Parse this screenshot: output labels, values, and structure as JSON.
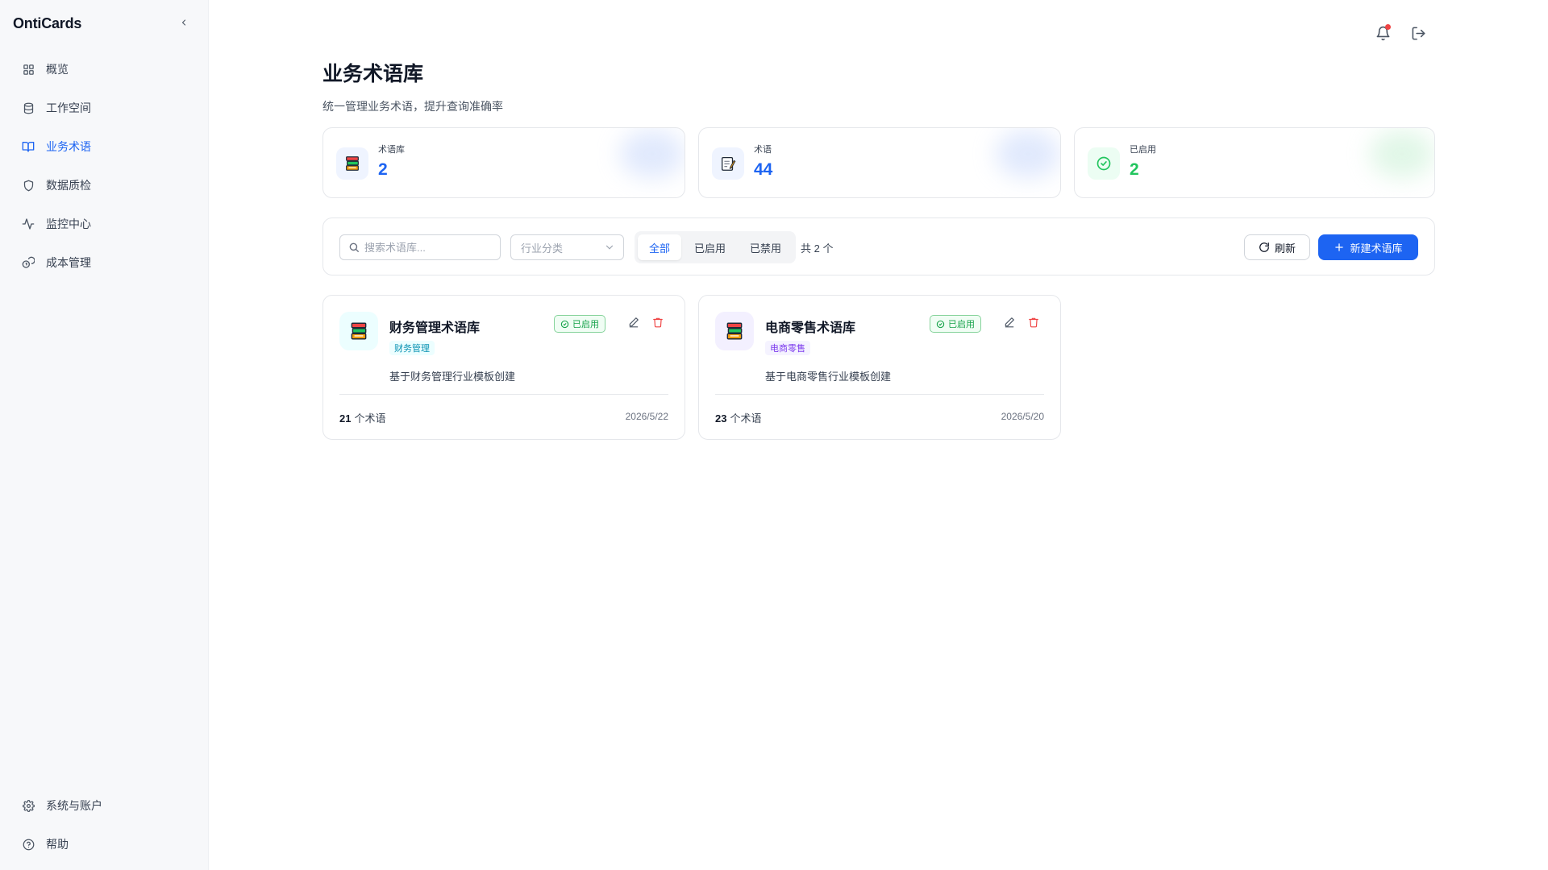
{
  "app": {
    "brand": "OntiCards"
  },
  "sidebar": {
    "items": [
      {
        "label": "概览",
        "icon": "grid-icon"
      },
      {
        "label": "工作空间",
        "icon": "database-icon"
      },
      {
        "label": "业务术语",
        "icon": "book-icon",
        "active": true
      },
      {
        "label": "数据质检",
        "icon": "shield-icon"
      },
      {
        "label": "监控中心",
        "icon": "activity-icon"
      },
      {
        "label": "成本管理",
        "icon": "coins-icon"
      }
    ],
    "bottom_items": [
      {
        "label": "系统与账户",
        "icon": "gear-icon"
      },
      {
        "label": "帮助",
        "icon": "help-circle-icon"
      }
    ]
  },
  "page": {
    "title": "业务术语库",
    "subtitle": "统一管理业务术语，提升查询准确率"
  },
  "stats": [
    {
      "label": "术语库",
      "value": "2",
      "color": "#1d64f2",
      "icon": "books-icon"
    },
    {
      "label": "术语",
      "value": "44",
      "color": "#1d64f2",
      "icon": "notepad-icon"
    },
    {
      "label": "已启用",
      "value": "2",
      "color": "#22c55e",
      "icon": "check-circle-icon"
    }
  ],
  "toolbar": {
    "search_placeholder": "搜索术语库...",
    "industry_placeholder": "行业分类",
    "filters": [
      "全部",
      "已启用",
      "已禁用"
    ],
    "active_filter": "全部",
    "total": "共 2 个",
    "refresh_label": "刷新",
    "new_label": "新建术语库"
  },
  "cards": [
    {
      "title": "财务管理术语库",
      "tag": "财务管理",
      "tag_color": "#0891b2",
      "tag_bg": "#ecfeff",
      "icon_bg": "#ecfeff",
      "status": "已启用",
      "description": "基于财务管理行业模板创建",
      "count": "21",
      "count_suffix": "个术语",
      "date": "2026/5/22"
    },
    {
      "title": "电商零售术语库",
      "tag": "电商零售",
      "tag_color": "#7c3aed",
      "tag_bg": "#f5f3ff",
      "icon_bg": "#f3f0ff",
      "status": "已启用",
      "description": "基于电商零售行业模板创建",
      "count": "23",
      "count_suffix": "个术语",
      "date": "2026/5/20"
    }
  ]
}
